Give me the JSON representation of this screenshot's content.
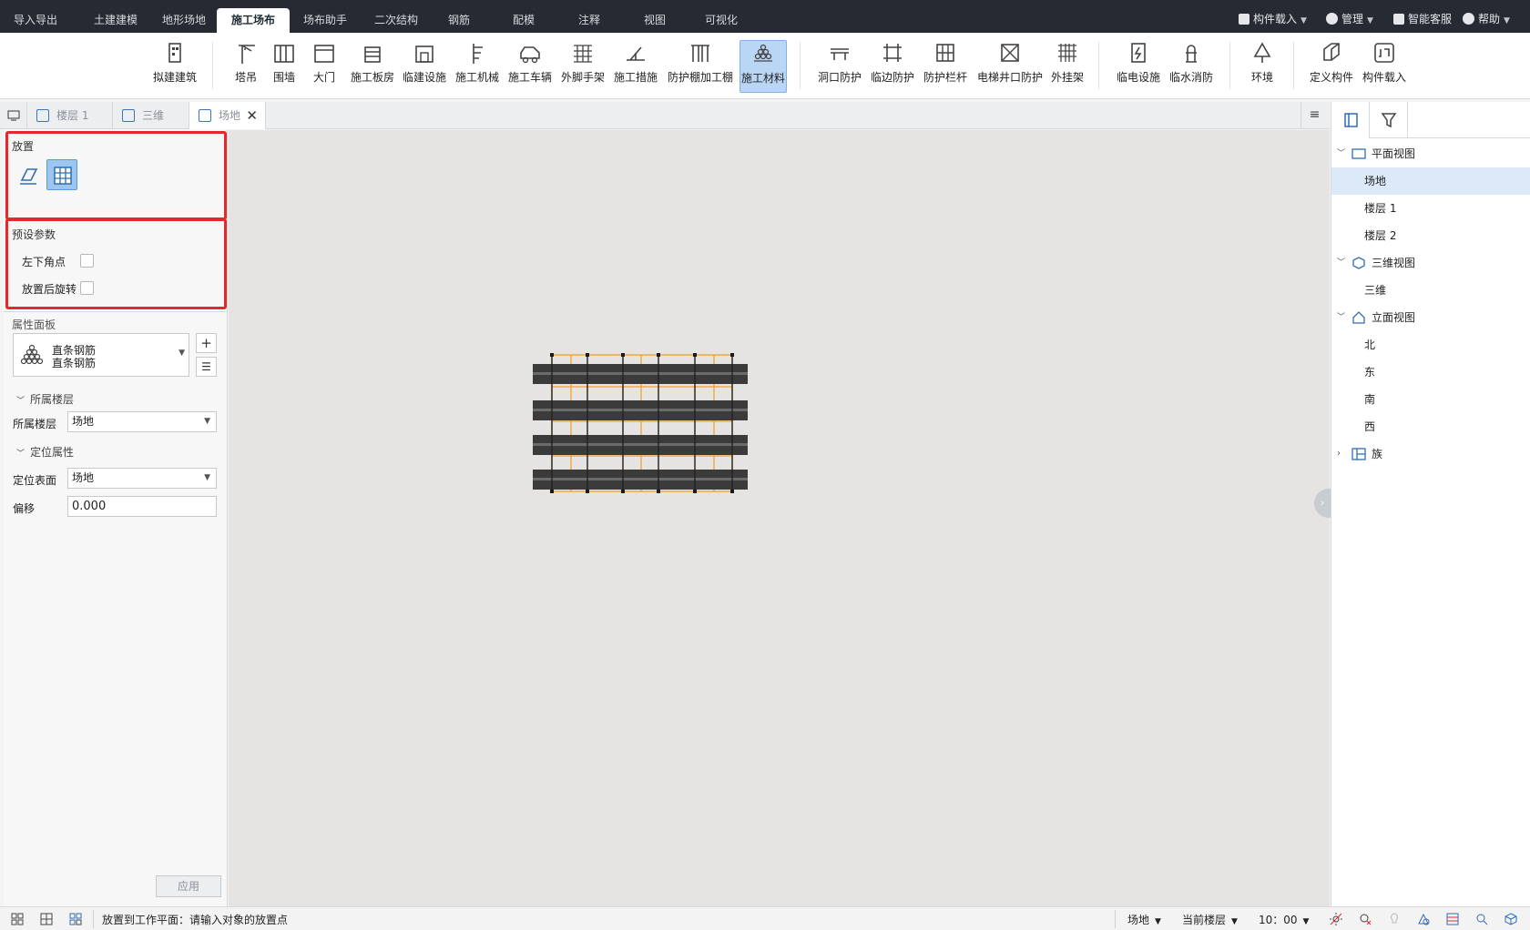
{
  "menu": {
    "tabs": [
      "导入导出",
      "土建建模",
      "地形场地",
      "施工场布",
      "场布助手",
      "二次结构",
      "钢筋",
      "配模",
      "注释",
      "视图",
      "可视化"
    ],
    "active_tab": "施工场布"
  },
  "top_right": {
    "component_import": "构件载入",
    "manage": "管理",
    "service": "智能客服",
    "help": "帮助"
  },
  "ribbon": {
    "buttons": [
      "拟建建筑",
      "塔吊",
      "围墙",
      "大门",
      "施工板房",
      "临建设施",
      "施工机械",
      "施工车辆",
      "外脚手架",
      "施工措施",
      "防护棚加工棚",
      "施工材料",
      "洞口防护",
      "临边防护",
      "防护栏杆",
      "电梯井口防护",
      "外挂架",
      "临电设施",
      "临水消防",
      "环境",
      "定义构件",
      "构件载入"
    ],
    "selected": "施工材料"
  },
  "doc_tabs": {
    "tabs": [
      "楼层 1",
      "三维",
      "场地"
    ],
    "active": "场地",
    "close": "✕"
  },
  "left_panel": {
    "placement_title": "放置",
    "preset_title": "预设参数",
    "checkbox_bottom_left": "左下角点",
    "checkbox_rotate": "放置后旋转",
    "property_title": "属性面板",
    "component_name_1": "直条钢筋",
    "component_name_2": "直条钢筋",
    "group_floor": "所属楼层",
    "floor_label": "所属楼层",
    "floor_value": "场地",
    "group_position": "定位属性",
    "surface_label": "定位表面",
    "surface_value": "场地",
    "offset_label": "偏移",
    "offset_value": "0.000",
    "apply_button": "应用"
  },
  "tree": {
    "plan_view": "平面视图",
    "plan_items": [
      "场地",
      "楼层 1",
      "楼层 2"
    ],
    "view_3d": "三维视图",
    "items_3d": [
      "三维"
    ],
    "elevation_view": "立面视图",
    "elevation_items": [
      "北",
      "东",
      "南",
      "西"
    ],
    "family": "族"
  },
  "status": {
    "prompt": "放置到工作平面：请输入对象的放置点",
    "level": "场地",
    "current_floor": "当前楼层",
    "time": "10：00"
  },
  "colors": {
    "topbar_bg": "#262b33",
    "accent_selected": "#b9d7f5",
    "highlight_red": "#e8262b",
    "rebar_orange": "#f0a020",
    "rebar_dark": "#3b3b3b",
    "canvas_bg": "#e5e4e2"
  }
}
